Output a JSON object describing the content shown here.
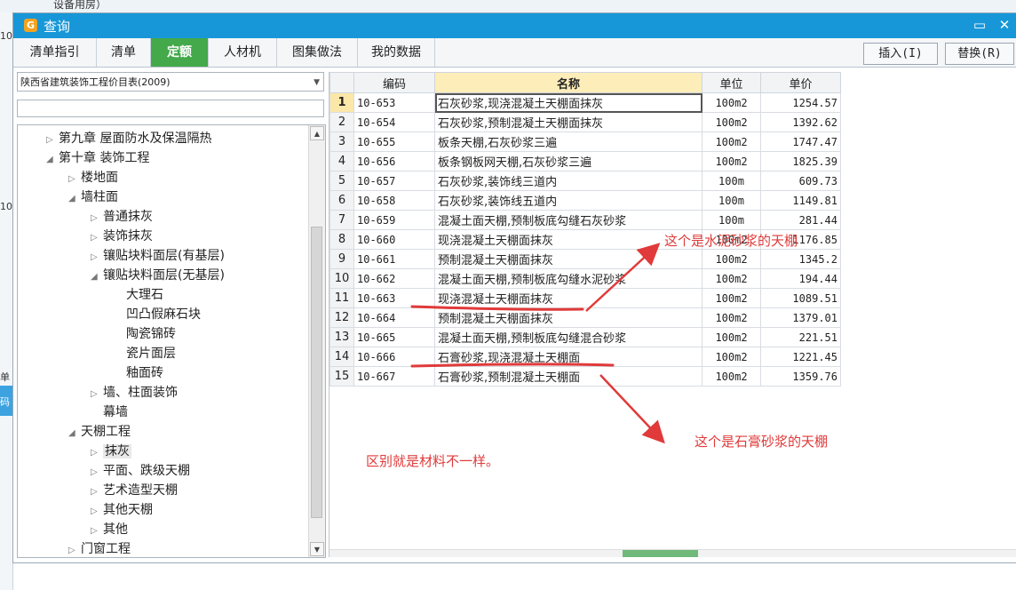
{
  "background": {
    "top_text": "设备用房）",
    "left_texts": [
      "10",
      "10",
      "单",
      "码"
    ]
  },
  "dialog": {
    "title": "查询",
    "tabs": [
      "清单指引",
      "清单",
      "定额",
      "人材机",
      "图集做法",
      "我的数据"
    ],
    "active_tab": "定额",
    "buttons": {
      "insert": "插入(I)",
      "replace": "替换(R)"
    }
  },
  "library": {
    "selected": "陕西省建筑装饰工程价目表(2009)",
    "search_value": ""
  },
  "tree": [
    {
      "label": "第九章 屋面防水及保温隔热",
      "level": 1,
      "state": "collapsed"
    },
    {
      "label": "第十章 装饰工程",
      "level": 1,
      "state": "expanded"
    },
    {
      "label": "楼地面",
      "level": 2,
      "state": "collapsed"
    },
    {
      "label": "墙柱面",
      "level": 2,
      "state": "expanded"
    },
    {
      "label": "普通抹灰",
      "level": 3,
      "state": "collapsed"
    },
    {
      "label": "装饰抹灰",
      "level": 3,
      "state": "collapsed"
    },
    {
      "label": "镶贴块料面层(有基层)",
      "level": 3,
      "state": "collapsed"
    },
    {
      "label": "镶贴块料面层(无基层)",
      "level": 3,
      "state": "expanded"
    },
    {
      "label": "大理石",
      "level": 4,
      "state": "leaf"
    },
    {
      "label": "凹凸假麻石块",
      "level": 4,
      "state": "leaf"
    },
    {
      "label": "陶瓷锦砖",
      "level": 4,
      "state": "leaf"
    },
    {
      "label": "瓷片面层",
      "level": 4,
      "state": "leaf"
    },
    {
      "label": "釉面砖",
      "level": 4,
      "state": "leaf"
    },
    {
      "label": "墙、柱面装饰",
      "level": 3,
      "state": "collapsed"
    },
    {
      "label": "幕墙",
      "level": 3,
      "state": "leaf"
    },
    {
      "label": "天棚工程",
      "level": 2,
      "state": "expanded"
    },
    {
      "label": "抹灰",
      "level": 3,
      "state": "collapsed",
      "selected": true
    },
    {
      "label": "平面、跌级天棚",
      "level": 3,
      "state": "collapsed"
    },
    {
      "label": "艺术造型天棚",
      "level": 3,
      "state": "collapsed"
    },
    {
      "label": "其他天棚",
      "level": 3,
      "state": "collapsed"
    },
    {
      "label": "其他",
      "level": 3,
      "state": "collapsed"
    },
    {
      "label": "门窗工程",
      "level": 2,
      "state": "collapsed"
    }
  ],
  "table": {
    "headers": [
      "编码",
      "名称",
      "单位",
      "单价"
    ],
    "rows": [
      {
        "no": "1",
        "code": "10-653",
        "name": "石灰砂浆,现浇混凝土天棚面抹灰",
        "unit": "100m2",
        "price": "1254.57"
      },
      {
        "no": "2",
        "code": "10-654",
        "name": "石灰砂浆,预制混凝土天棚面抹灰",
        "unit": "100m2",
        "price": "1392.62"
      },
      {
        "no": "3",
        "code": "10-655",
        "name": "板条天棚,石灰砂浆三遍",
        "unit": "100m2",
        "price": "1747.47"
      },
      {
        "no": "4",
        "code": "10-656",
        "name": "板条钢板网天棚,石灰砂浆三遍",
        "unit": "100m2",
        "price": "1825.39"
      },
      {
        "no": "5",
        "code": "10-657",
        "name": "石灰砂浆,装饰线三道内",
        "unit": "100m",
        "price": "609.73"
      },
      {
        "no": "6",
        "code": "10-658",
        "name": "石灰砂浆,装饰线五道内",
        "unit": "100m",
        "price": "1149.81"
      },
      {
        "no": "7",
        "code": "10-659",
        "name": "混凝土面天棚,预制板底勾缝石灰砂浆",
        "unit": "100m",
        "price": "281.44"
      },
      {
        "no": "8",
        "code": "10-660",
        "name": "现浇混凝土天棚面抹灰",
        "unit": "100m2",
        "price": "1176.85"
      },
      {
        "no": "9",
        "code": "10-661",
        "name": "预制混凝土天棚面抹灰",
        "unit": "100m2",
        "price": "1345.2"
      },
      {
        "no": "10",
        "code": "10-662",
        "name": "混凝土面天棚,预制板底勾缝水泥砂浆",
        "unit": "100m2",
        "price": "194.44"
      },
      {
        "no": "11",
        "code": "10-663",
        "name": "现浇混凝土天棚面抹灰",
        "unit": "100m2",
        "price": "1089.51"
      },
      {
        "no": "12",
        "code": "10-664",
        "name": "预制混凝土天棚面抹灰",
        "unit": "100m2",
        "price": "1379.01"
      },
      {
        "no": "13",
        "code": "10-665",
        "name": "混凝土面天棚,预制板底勾缝混合砂浆",
        "unit": "100m2",
        "price": "221.51"
      },
      {
        "no": "14",
        "code": "10-666",
        "name": "石膏砂浆,现浇混凝土天棚面",
        "unit": "100m2",
        "price": "1221.45"
      },
      {
        "no": "15",
        "code": "10-667",
        "name": "石膏砂浆,预制混凝土天棚面",
        "unit": "100m2",
        "price": "1359.76"
      }
    ]
  },
  "annotations": {
    "top": "这个是水泥砂浆的天棚",
    "bottom": "这个是石膏砂浆的天棚",
    "note": "区别就是材料不一样。"
  },
  "colors": {
    "titlebar": "#1797d8",
    "active_tab": "#43a94a",
    "annotation": "#e03a3a",
    "header_highlight": "#fdedb8"
  }
}
